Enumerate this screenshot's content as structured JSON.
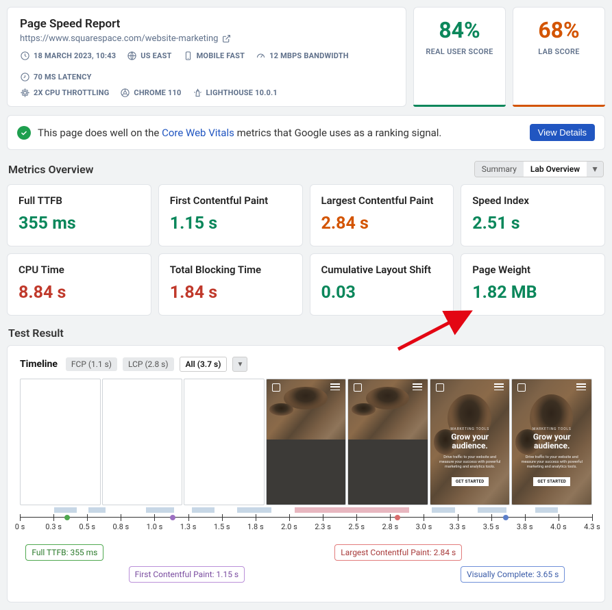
{
  "report": {
    "title": "Page Speed Report",
    "url": "https://www.squarespace.com/website-marketing",
    "meta": {
      "date": "18 MARCH 2023, 10:43",
      "region": "US EAST",
      "device": "MOBILE FAST",
      "bandwidth": "12 MBPS BANDWIDTH",
      "latency": "70 MS LATENCY",
      "throttle": "2X CPU THROTTLING",
      "browser": "CHROME 110",
      "lighthouse": "LIGHTHOUSE 10.0.1"
    }
  },
  "scores": {
    "real": {
      "value": "84%",
      "label": "REAL USER SCORE",
      "color": "#0b875b"
    },
    "lab": {
      "value": "68%",
      "label": "LAB SCORE",
      "color": "#d35400"
    }
  },
  "cwv": {
    "pre": "This page does well on the ",
    "link": "Core Web Vitals",
    "post": " metrics that Google uses as a ranking signal.",
    "button": "View Details"
  },
  "overview": {
    "title": "Metrics Overview",
    "segs": {
      "summary": "Summary",
      "lab": "Lab Overview"
    }
  },
  "metrics": [
    {
      "name": "Full TTFB",
      "value": "355 ms",
      "cls": "mv-good"
    },
    {
      "name": "First Contentful Paint",
      "value": "1.15 s",
      "cls": "mv-good"
    },
    {
      "name": "Largest Contentful Paint",
      "value": "2.84 s",
      "cls": "mv-warn"
    },
    {
      "name": "Speed Index",
      "value": "2.51 s",
      "cls": "mv-good"
    },
    {
      "name": "CPU Time",
      "value": "8.84 s",
      "cls": "mv-bad"
    },
    {
      "name": "Total Blocking Time",
      "value": "1.84 s",
      "cls": "mv-bad"
    },
    {
      "name": "Cumulative Layout Shift",
      "value": "0.03",
      "cls": "mv-good"
    },
    {
      "name": "Page Weight",
      "value": "1.82 MB",
      "cls": "mv-good"
    }
  ],
  "test": {
    "title": "Test Result",
    "timeline_label": "Timeline",
    "chips": {
      "fcp": "FCP (1.1 s)",
      "lcp": "LCP (2.8 s)",
      "all": "All (3.7 s)"
    },
    "frame_overlay": {
      "eyebrow": "MARKETING TOOLS",
      "heading": "Grow your audience.",
      "sub": "Drive traffic to your website and measure your success with powerful marketing and analytics tools.",
      "cta": "GET STARTED"
    }
  },
  "ticks": [
    "0 s",
    "0.3 s",
    "0.5 s",
    "0.8 s",
    "1.0 s",
    "1.3 s",
    "1.5 s",
    "1.8 s",
    "2.0 s",
    "2.3 s",
    "2.5 s",
    "2.8 s",
    "3.0 s",
    "3.3 s",
    "3.5 s",
    "3.8 s",
    "4.0 s",
    "4.3 s"
  ],
  "callouts": {
    "ttfb": "Full TTFB: 355 ms",
    "fcp": "First Contentful Paint: 1.15 s",
    "lcp": "Largest Contentful Paint: 2.84 s",
    "vc": "Visually Complete: 3.65 s"
  },
  "chart_data": {
    "type": "bar",
    "categories": [
      "Full TTFB",
      "First Contentful Paint",
      "Largest Contentful Paint",
      "Speed Index",
      "CPU Time",
      "Total Blocking Time",
      "Cumulative Layout Shift",
      "Page Weight"
    ],
    "values_display": [
      "355 ms",
      "1.15 s",
      "2.84 s",
      "2.51 s",
      "8.84 s",
      "1.84 s",
      "0.03",
      "1.82 MB"
    ],
    "timeline_events": {
      "Full TTFB": 0.355,
      "First Contentful Paint": 1.15,
      "Largest Contentful Paint": 2.84,
      "Visually Complete": 3.65
    },
    "xlim": [
      0,
      4.3
    ],
    "xlabel": "seconds"
  }
}
